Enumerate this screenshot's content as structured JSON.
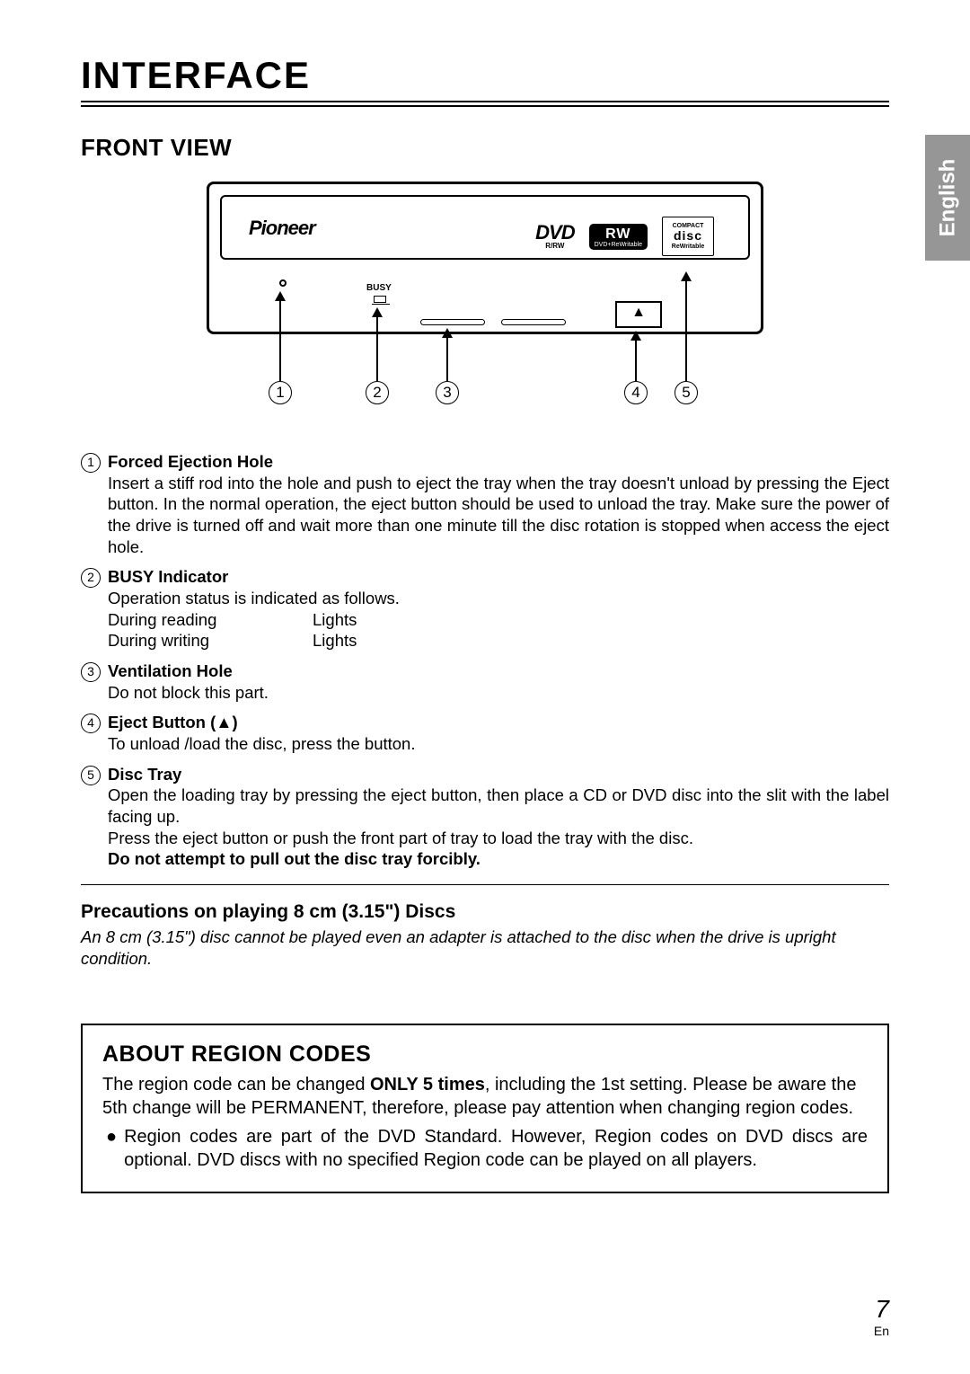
{
  "title": "INTERFACE",
  "lang_tab": "English",
  "front_view_heading": "FRONT VIEW",
  "diagram": {
    "brand": "Pioneer",
    "dvd_text": "DVD",
    "dvd_sub": "R/RW",
    "rw_mid": "RW",
    "rw_bot": "DVD+ReWritable",
    "disc_top": "COMPACT",
    "disc_mid": "disc",
    "disc_bot": "ReWritable",
    "busy_label": "BUSY",
    "eject_glyph": "▲",
    "callouts": [
      "1",
      "2",
      "3",
      "4",
      "5"
    ]
  },
  "items": [
    {
      "num": "1",
      "title": "Forced Ejection Hole",
      "text": "Insert a stiff rod into the hole and push to eject the tray when the tray doesn't unload by pressing the Eject button. In the normal operation, the eject button should be used to unload the tray. Make sure the power of the drive is turned off and wait more than one minute till the disc rotation is stopped when access the eject hole."
    },
    {
      "num": "2",
      "title": "BUSY Indicator",
      "lead": "Operation status is indicated as follows.",
      "rows": [
        {
          "c1": "During reading",
          "c2": "Lights"
        },
        {
          "c1": "During writing",
          "c2": "Lights"
        }
      ]
    },
    {
      "num": "3",
      "title": "Ventilation Hole",
      "text": "Do not block this part."
    },
    {
      "num": "4",
      "title": "Eject Button (▲)",
      "text": "To unload /load the disc, press the button."
    },
    {
      "num": "5",
      "title": "Disc Tray",
      "text": "Open the loading tray by pressing the eject button, then place a CD or DVD disc into the slit with the label facing up.",
      "text2": "Press the eject button or push the front part of tray to load the tray with the disc.",
      "bold_text": "Do not attempt to pull out the disc tray forcibly."
    }
  ],
  "precaution_heading": "Precautions on playing 8 cm (3.15\") Discs",
  "precaution_text": "An 8 cm (3.15\") disc cannot be played even an adapter is attached to the disc when the drive is upright condition.",
  "region": {
    "heading": "ABOUT REGION CODES",
    "p1a": "The region code can be changed ",
    "p1b": "ONLY 5 times",
    "p1c": ", including the 1st setting. Please be aware the 5th change will be PERMANENT, therefore, please pay attention when changing region codes.",
    "bullet": "Region codes are part of the DVD Standard. However, Region codes on DVD discs are optional. DVD discs with no specified Region code can be played on all players."
  },
  "page_number": "7",
  "page_lang": "En"
}
